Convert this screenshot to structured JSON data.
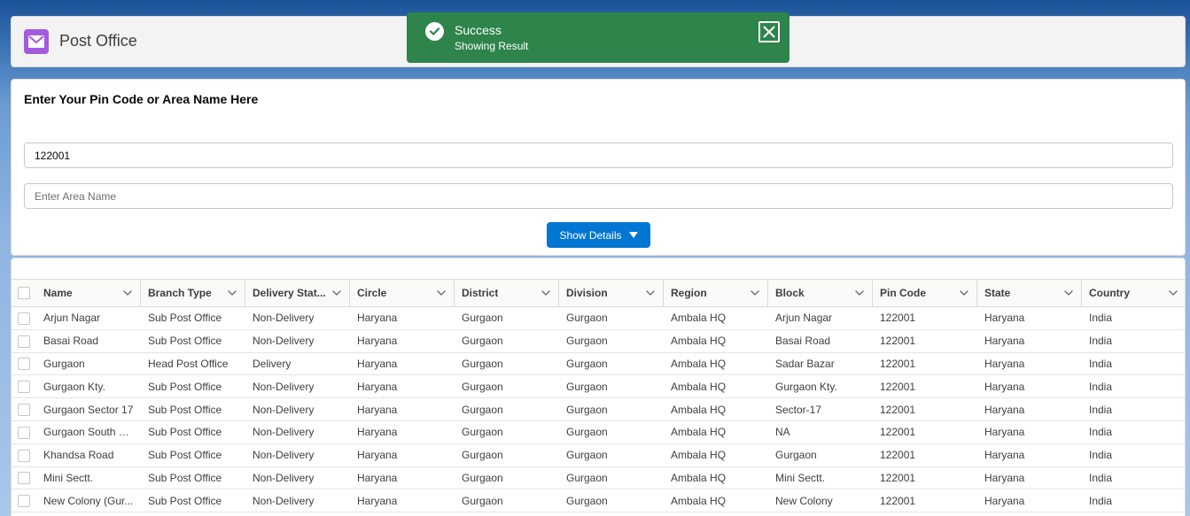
{
  "header": {
    "title": "Post Office",
    "icon": "envelope-icon",
    "icon_color": "#a35be0"
  },
  "toast": {
    "title": "Success",
    "message": "Showing Result",
    "color": "#2e844a"
  },
  "search": {
    "label": "Enter Your Pin Code or Area Name Here",
    "pin_value": "122001",
    "area_placeholder": "Enter Area Name",
    "button_label": "Show Details",
    "button_color": "#0176d3"
  },
  "table": {
    "columns": [
      "Name",
      "Branch Type",
      "Delivery Stat...",
      "Circle",
      "District",
      "Division",
      "Region",
      "Block",
      "Pin Code",
      "State",
      "Country"
    ],
    "rows": [
      [
        "Arjun Nagar",
        "Sub Post Office",
        "Non-Delivery",
        "Haryana",
        "Gurgaon",
        "Gurgaon",
        "Ambala HQ",
        "Arjun Nagar",
        "122001",
        "Haryana",
        "India"
      ],
      [
        "Basai Road",
        "Sub Post Office",
        "Non-Delivery",
        "Haryana",
        "Gurgaon",
        "Gurgaon",
        "Ambala HQ",
        "Basai Road",
        "122001",
        "Haryana",
        "India"
      ],
      [
        "Gurgaon",
        "Head Post Office",
        "Delivery",
        "Haryana",
        "Gurgaon",
        "Gurgaon",
        "Ambala HQ",
        "Sadar Bazar",
        "122001",
        "Haryana",
        "India"
      ],
      [
        "Gurgaon Kty.",
        "Sub Post Office",
        "Non-Delivery",
        "Haryana",
        "Gurgaon",
        "Gurgaon",
        "Ambala HQ",
        "Gurgaon Kty.",
        "122001",
        "Haryana",
        "India"
      ],
      [
        "Gurgaon Sector 17",
        "Sub Post Office",
        "Non-Delivery",
        "Haryana",
        "Gurgaon",
        "Gurgaon",
        "Ambala HQ",
        "Sector-17",
        "122001",
        "Haryana",
        "India"
      ],
      [
        "Gurgaon South Ci...",
        "Sub Post Office",
        "Non-Delivery",
        "Haryana",
        "Gurgaon",
        "Gurgaon",
        "Ambala HQ",
        "NA",
        "122001",
        "Haryana",
        "India"
      ],
      [
        "Khandsa Road",
        "Sub Post Office",
        "Non-Delivery",
        "Haryana",
        "Gurgaon",
        "Gurgaon",
        "Ambala HQ",
        "Gurgaon",
        "122001",
        "Haryana",
        "India"
      ],
      [
        "Mini Sectt.",
        "Sub Post Office",
        "Non-Delivery",
        "Haryana",
        "Gurgaon",
        "Gurgaon",
        "Ambala HQ",
        "Mini Sectt.",
        "122001",
        "Haryana",
        "India"
      ],
      [
        "New Colony (Gur...",
        "Sub Post Office",
        "Non-Delivery",
        "Haryana",
        "Gurgaon",
        "Gurgaon",
        "Ambala HQ",
        "New Colony",
        "122001",
        "Haryana",
        "India"
      ]
    ]
  }
}
